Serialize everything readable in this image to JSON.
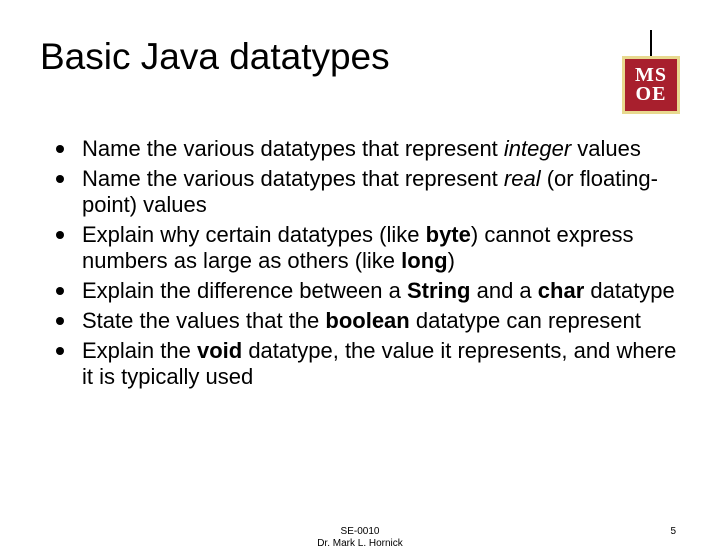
{
  "title": "Basic Java datatypes",
  "logo": {
    "top": "MS",
    "bottom": "OE"
  },
  "bullets": [
    {
      "pre": "Name the various datatypes that represent ",
      "emType": "i",
      "em": "integer",
      "post": " values"
    },
    {
      "pre": "Name the various datatypes that represent ",
      "emType": "i",
      "em": "real",
      "post": " (or floating-point) values"
    },
    {
      "pre": "Explain why certain datatypes (like ",
      "emType": "b",
      "em": "byte",
      "mid": ") cannot express numbers as large as others (like ",
      "em2": "long",
      "post": ")"
    },
    {
      "pre": "Explain the difference between a ",
      "emType": "b",
      "em": "String",
      "mid": " and a ",
      "em2": "char",
      "post": " datatype"
    },
    {
      "pre": "State the values that the ",
      "emType": "b",
      "em": "boolean",
      "post": " datatype can represent"
    },
    {
      "pre": "Explain the ",
      "emType": "b",
      "em": "void",
      "post": " datatype, the value it represents, and where it is typically used"
    }
  ],
  "footer": {
    "line1": "SE-0010",
    "line2": "Dr. Mark L. Hornick",
    "page": "5"
  }
}
